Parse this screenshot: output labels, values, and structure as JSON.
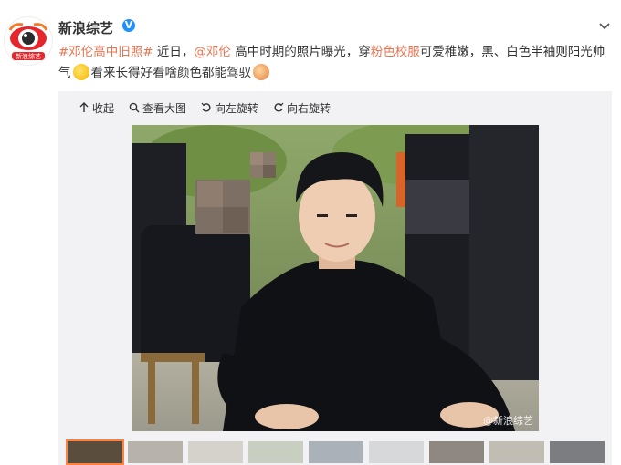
{
  "account": {
    "name": "新浪综艺",
    "verified_badge": "V",
    "avatar_caption": "新浪综艺"
  },
  "post": {
    "tag": "#邓伦高中旧照#",
    "text_1": " 近日，",
    "mention": "@邓伦",
    "text_2": " 高中时期的照片曝光，穿",
    "keyword": "粉色校服",
    "text_3": "可爱稚嫩，黑、白色半袖则阳光帅气",
    "text_4": "看来长得好看啥颜色都能驾驭"
  },
  "toolbar": {
    "collapse": "收起",
    "view_large": "查看大图",
    "rotate_left": "向左旋转",
    "rotate_right": "向右旋转"
  },
  "photo": {
    "watermark": "@新浪综艺"
  },
  "thumbnails": {
    "count": 9,
    "active_index": 0
  },
  "colors": {
    "link": "#eb7350",
    "verify": "#1e90ff",
    "active_thumb": "#ff8140"
  }
}
